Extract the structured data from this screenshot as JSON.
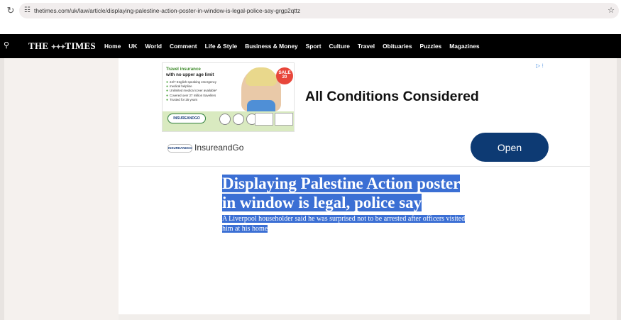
{
  "browser": {
    "url": "thetimes.com/uk/law/article/displaying-palestine-action-poster-in-window-is-legal-police-say-grgp2qttz",
    "reload_icon": "reload-icon",
    "site_info_icon": "tune-icon",
    "bookmark_icon": "star-icon"
  },
  "nav": {
    "logo_left": "THE",
    "logo_right": "TIMES",
    "items": [
      "Home",
      "UK",
      "World",
      "Comment",
      "Life & Style",
      "Business & Money",
      "Sport",
      "Culture",
      "Travel",
      "Obituaries",
      "Puzzles",
      "Magazines"
    ]
  },
  "ad": {
    "image": {
      "title": "Travel insurance",
      "subtitle": "with no upper age limit",
      "bullets": [
        "24/7 English speaking emergency",
        "medical helpline",
        "Unlimited medical cover available*",
        "Covered over 27 million travellers",
        "Trusted for 25 years"
      ],
      "brand": "INSUREANDGO",
      "sale_line1": "",
      "sale_line2": "SALE",
      "sale_line3": "20"
    },
    "headline": "All Conditions Considered",
    "advertiser_name": "InsureandGo",
    "advertiser_logo": "INSUREANDGO",
    "open_label": "Open",
    "adchoices_label": "▷ ⁝"
  },
  "article": {
    "headline_line1": "Displaying Palestine Action poster",
    "headline_line2": "in window is legal, police say",
    "standfirst_line1": "A Liverpool householder said he was surprised not to be arrested after officers visited",
    "standfirst_line2": "him at his home"
  },
  "colors": {
    "nav_background": "#000000",
    "selection": "#3b6fd4",
    "open_button": "#0d3a73",
    "page_gutter": "#f5f1ee"
  }
}
